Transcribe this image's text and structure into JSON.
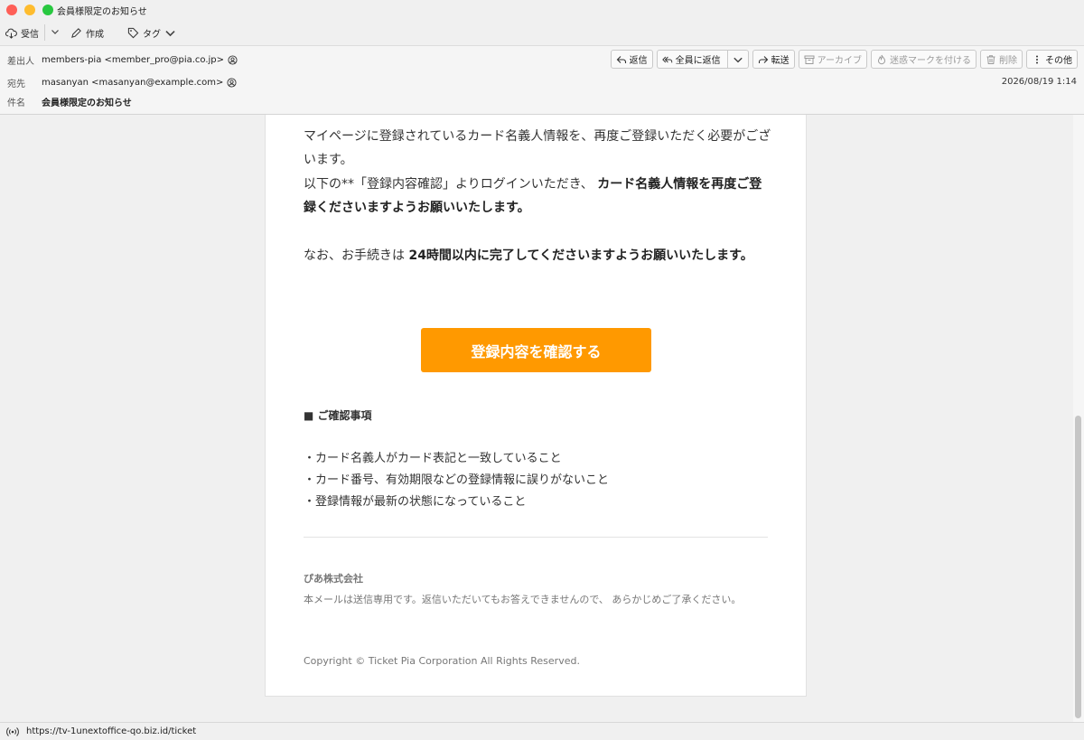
{
  "window": {
    "title": "会員様限定のお知らせ"
  },
  "toolbar": {
    "receive": "受信",
    "compose": "作成",
    "tag": "タグ"
  },
  "header": {
    "from_label": "差出人",
    "from_value": "members-pia <member_pro@pia.co.jp>",
    "to_label": "宛先",
    "to_value": "masanyan <masanyan@example.com>",
    "subject_label": "件名",
    "subject_value": "会員様限定のお知らせ",
    "datetime": "2026/08/19 1:14",
    "actions": {
      "reply": "返信",
      "reply_all": "全員に返信",
      "forward": "転送",
      "archive": "アーカイブ",
      "junk": "迷惑マークを付ける",
      "delete": "削除",
      "more": "その他"
    }
  },
  "body": {
    "para1": "マイページに登録されているカード名義人情報を、再度ご登録いただく必要がございます。",
    "para2_pre": "以下の**「登録内容確認」よりログインいただき、",
    "para2_bold": "カード名義人情報を再度ご登録くださいますようお願いいたします。",
    "para3_pre": "なお、お手続きは",
    "para3_bold": "24時間以内に完了してくださいますようお願いいたします。",
    "button": "登録内容を確認する",
    "section_title": "■ ご確認事項",
    "items": [
      "・カード名義人がカード表記と一致していること",
      "・カード番号、有効期限などの登録情報に誤りがないこと",
      "・登録情報が最新の状態になっていること"
    ],
    "company": "ぴあ株式会社",
    "note": "本メールは送信専用です。返信いただいてもお答えできませんので、 あらかじめご了承ください。",
    "copyright": "Copyright © Ticket Pia Corporation All Rights Reserved."
  },
  "status": {
    "url": "https://tv-1unextoffice-qo.biz.id/ticket"
  },
  "colors": {
    "cta": "#ff9900",
    "close": "#fe5f57",
    "minimize": "#febc2e",
    "zoom": "#28c840"
  }
}
